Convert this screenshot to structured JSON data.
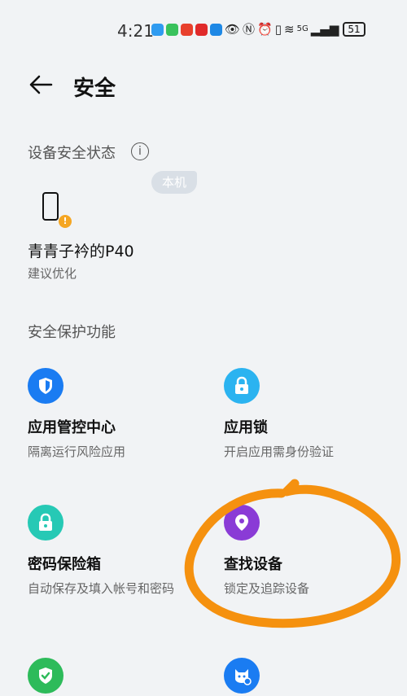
{
  "status_bar": {
    "time": "4:21",
    "network": "5G",
    "battery": "51"
  },
  "header": {
    "title": "安全"
  },
  "device_status": {
    "section_label": "设备安全状态",
    "tag": "本机",
    "device_name": "青青子衿的P40",
    "device_status_text": "建议优化"
  },
  "protection": {
    "section_label": "安全保护功能",
    "features": [
      {
        "title": "应用管控中心",
        "subtitle": "隔离运行风险应用",
        "icon": "shield-icon",
        "color": "#1a7cf2"
      },
      {
        "title": "应用锁",
        "subtitle": "开启应用需身份验证",
        "icon": "padlock-icon",
        "color": "#2bb3f0"
      },
      {
        "title": "密码保险箱",
        "subtitle": "自动保存及填入帐号和密码",
        "icon": "padlock-icon",
        "color": "#26c9b5"
      },
      {
        "title": "查找设备",
        "subtitle": "锁定及追踪设备",
        "icon": "location-pin-icon",
        "color": "#8a3bd6"
      },
      {
        "title": "",
        "subtitle": "",
        "icon": "check-shield-icon",
        "color": "#2dbb5a"
      },
      {
        "title": "",
        "subtitle": "",
        "icon": "guardian-icon",
        "color": "#1a7cf2"
      }
    ]
  },
  "annotation_color": "#f5910f"
}
